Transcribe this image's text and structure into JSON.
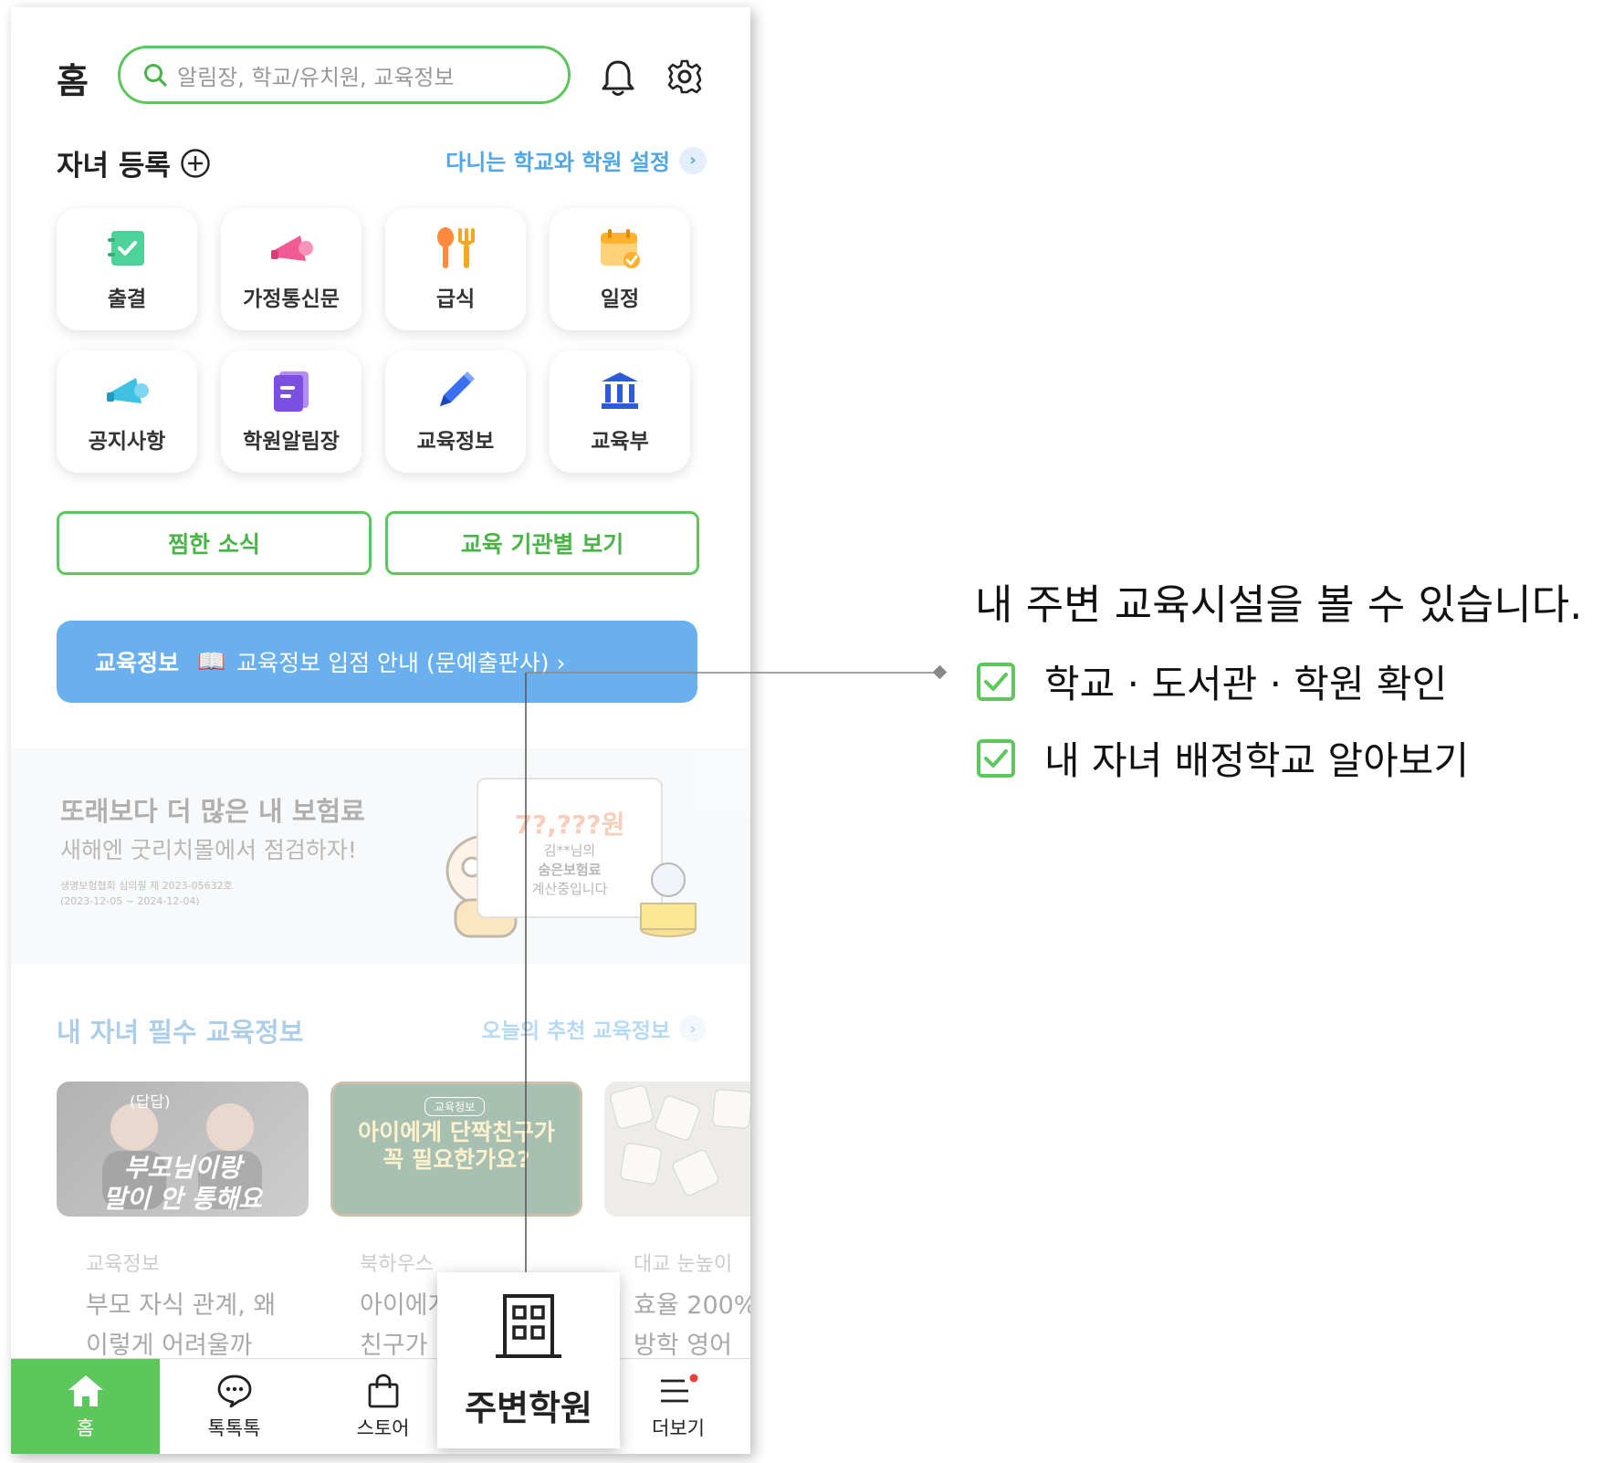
{
  "header": {
    "title": "홈",
    "search_placeholder": "알림장, 학교/유치원, 교육정보",
    "icons": [
      "search-icon",
      "bell-icon",
      "gear-icon"
    ]
  },
  "children": {
    "register_label": "자녀 등록",
    "school_setting_label": "다니는 학교와 학원 설정"
  },
  "menu": [
    {
      "label": "출결",
      "icon": "attendance-icon"
    },
    {
      "label": "가정통신문",
      "icon": "megaphone-icon"
    },
    {
      "label": "급식",
      "icon": "utensils-icon"
    },
    {
      "label": "일정",
      "icon": "calendar-icon"
    },
    {
      "label": "공지사항",
      "icon": "announcement-icon"
    },
    {
      "label": "학원알림장",
      "icon": "notebook-icon"
    },
    {
      "label": "교육정보",
      "icon": "pencil-icon"
    },
    {
      "label": "교육부",
      "icon": "government-building-icon"
    }
  ],
  "buttons": {
    "favorites": "찜한 소식",
    "by_institution": "교육 기관별 보기"
  },
  "banner": {
    "tag": "교육정보",
    "emoji": "📖",
    "text": "교육정보 입점 안내 (문예출판사) ›"
  },
  "ad": {
    "title": "또래보다 더 많은 내 보험료",
    "subtitle": "새해엔 굿리치몰에서 점검하자!",
    "note1": "생명보험협회 심의필 제 2023-05632호",
    "note2": "(2023-12-05 ~ 2024-12-04)",
    "price": "7?,???원",
    "card_line1": "김**님의",
    "card_line2": "숨은보험료",
    "card_line3": "계산중입니다"
  },
  "edu_section": {
    "title": "내 자녀 필수 교육정보",
    "link": "오늘의 추천 교육정보",
    "cards": [
      {
        "thumb_caption1": "부모님이랑",
        "thumb_caption2": "말이 안 통해요",
        "thumb_tag": "(답답)",
        "source": "교육정보",
        "title1": "부모 자식 관계, 왜",
        "title2": "이렇게 어려울까"
      },
      {
        "thumb_caption1": "아이에게 단짝친구가",
        "thumb_caption2": "꼭 필요한가요?",
        "thumb_tag": "교육정보",
        "source": "북하우스",
        "title1": "아이에게",
        "title2": "친구가"
      },
      {
        "thumb_caption1": "",
        "thumb_caption2": "",
        "thumb_tag": "",
        "source": "대교 눈높이",
        "title1": "효율 200%",
        "title2": "방학 영어"
      }
    ]
  },
  "tabbar": {
    "home": "홈",
    "talk": "톡톡톡",
    "store": "스토어",
    "more": "더보기"
  },
  "popup": {
    "label": "주변학원",
    "icon": "building-icon"
  },
  "annotation": {
    "title": "내 주변 교육시설을 볼 수 있습니다.",
    "item1": "학교 · 도서관 · 학원 확인",
    "item2": "내 자녀 배정학교 알아보기"
  },
  "colors": {
    "accent_green": "#5cc85c",
    "link_blue": "#52a6e6",
    "banner_blue": "#6ab0ee",
    "notification_red": "#e94040"
  }
}
